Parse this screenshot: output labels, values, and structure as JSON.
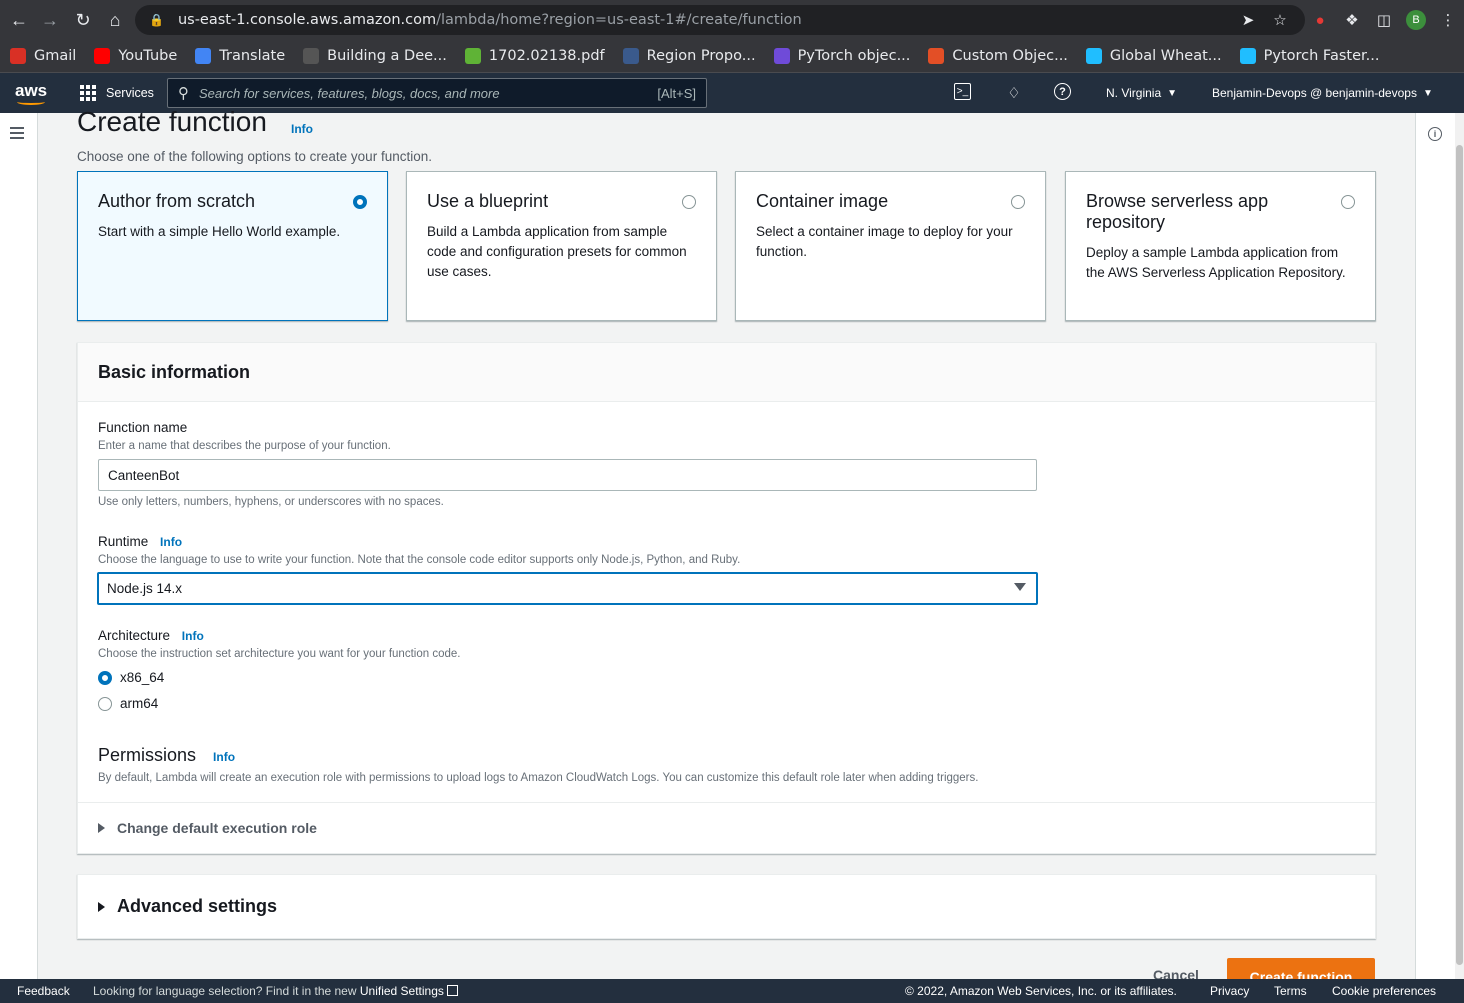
{
  "browser": {
    "url_host": "us-east-1.console.aws.amazon.com",
    "url_path": "/lambda/home?region=us-east-1#/create/function",
    "profile_initial": "B"
  },
  "bookmarks": [
    {
      "label": "Gmail",
      "color": "#d93025"
    },
    {
      "label": "YouTube",
      "color": "#ff0000"
    },
    {
      "label": "Translate",
      "color": "#4285f4"
    },
    {
      "label": "Building a Dee...",
      "color": "#555555"
    },
    {
      "label": "1702.02138.pdf",
      "color": "#5fb336"
    },
    {
      "label": "Region Propo...",
      "color": "#3a5a8c"
    },
    {
      "label": "PyTorch objec...",
      "color": "#6f4bd8"
    },
    {
      "label": "Custom Objec...",
      "color": "#e34f26"
    },
    {
      "label": "Global Wheat...",
      "color": "#20beff"
    },
    {
      "label": "Pytorch Faster...",
      "color": "#20beff"
    }
  ],
  "aws_header": {
    "logo": "aws",
    "services_label": "Services",
    "search_placeholder": "Search for services, features, blogs, docs, and more",
    "search_shortcut": "[Alt+S]",
    "region": "N. Virginia",
    "account": "Benjamin-Devops @ benjamin-devops"
  },
  "page": {
    "title": "Create function",
    "info": "Info",
    "subtitle": "Choose one of the following options to create your function."
  },
  "options": [
    {
      "title": "Author from scratch",
      "desc": "Start with a simple Hello World example.",
      "selected": true
    },
    {
      "title": "Use a blueprint",
      "desc": "Build a Lambda application from sample code and configuration presets for common use cases.",
      "selected": false
    },
    {
      "title": "Container image",
      "desc": "Select a container image to deploy for your function.",
      "selected": false
    },
    {
      "title": "Browse serverless app repository",
      "desc": "Deploy a sample Lambda application from the AWS Serverless Application Repository.",
      "selected": false
    }
  ],
  "basic_info": {
    "heading": "Basic information",
    "function_name": {
      "label": "Function name",
      "desc": "Enter a name that describes the purpose of your function.",
      "value": "CanteenBot",
      "hint": "Use only letters, numbers, hyphens, or underscores with no spaces."
    },
    "runtime": {
      "label": "Runtime",
      "info": "Info",
      "desc": "Choose the language to use to write your function. Note that the console code editor supports only Node.js, Python, and Ruby.",
      "value": "Node.js 14.x"
    },
    "architecture": {
      "label": "Architecture",
      "info": "Info",
      "desc": "Choose the instruction set architecture you want for your function code.",
      "options": [
        {
          "label": "x86_64",
          "selected": true
        },
        {
          "label": "arm64",
          "selected": false
        }
      ]
    },
    "permissions": {
      "title": "Permissions",
      "info": "Info",
      "desc": "By default, Lambda will create an execution role with permissions to upload logs to Amazon CloudWatch Logs. You can customize this default role later when adding triggers.",
      "expander": "Change default execution role"
    }
  },
  "advanced": {
    "label": "Advanced settings"
  },
  "actions": {
    "cancel": "Cancel",
    "create": "Create function"
  },
  "footer": {
    "feedback": "Feedback",
    "lang_text": "Looking for language selection? Find it in the new",
    "lang_link": "Unified Settings",
    "copyright": "© 2022, Amazon Web Services, Inc. or its affiliates.",
    "privacy": "Privacy",
    "terms": "Terms",
    "cookies": "Cookie preferences"
  },
  "colors": {
    "accent": "#0073bb",
    "primary_button": "#ec7211",
    "header": "#232f3e"
  }
}
